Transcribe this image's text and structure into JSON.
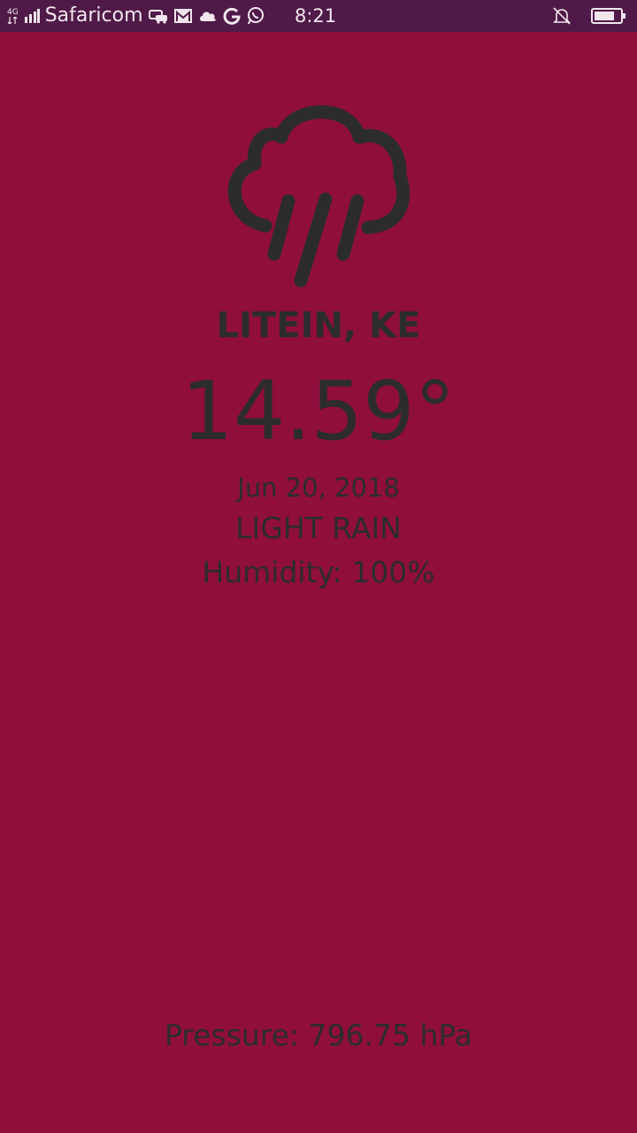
{
  "status_bar": {
    "network": "4G",
    "carrier": "Safaricom",
    "time": "8:21",
    "notification_icons": [
      "car-icon",
      "gmail-icon",
      "cloud-icon",
      "google-icon",
      "whatsapp-icon"
    ],
    "right_icons": [
      "bell-muted-icon",
      "battery-icon"
    ],
    "background_color": "#4f1a47"
  },
  "weather": {
    "condition_icon": "rain-cloud-icon",
    "city": "LITEIN, KE",
    "temperature": "14.59°",
    "date": "Jun 20, 2018",
    "description": "LIGHT RAIN",
    "humidity": "Humidity: 100%",
    "pressure": "Pressure: 796.75 hPa",
    "background_color": "#8f0e3c",
    "text_color": "#2c2c2e"
  }
}
